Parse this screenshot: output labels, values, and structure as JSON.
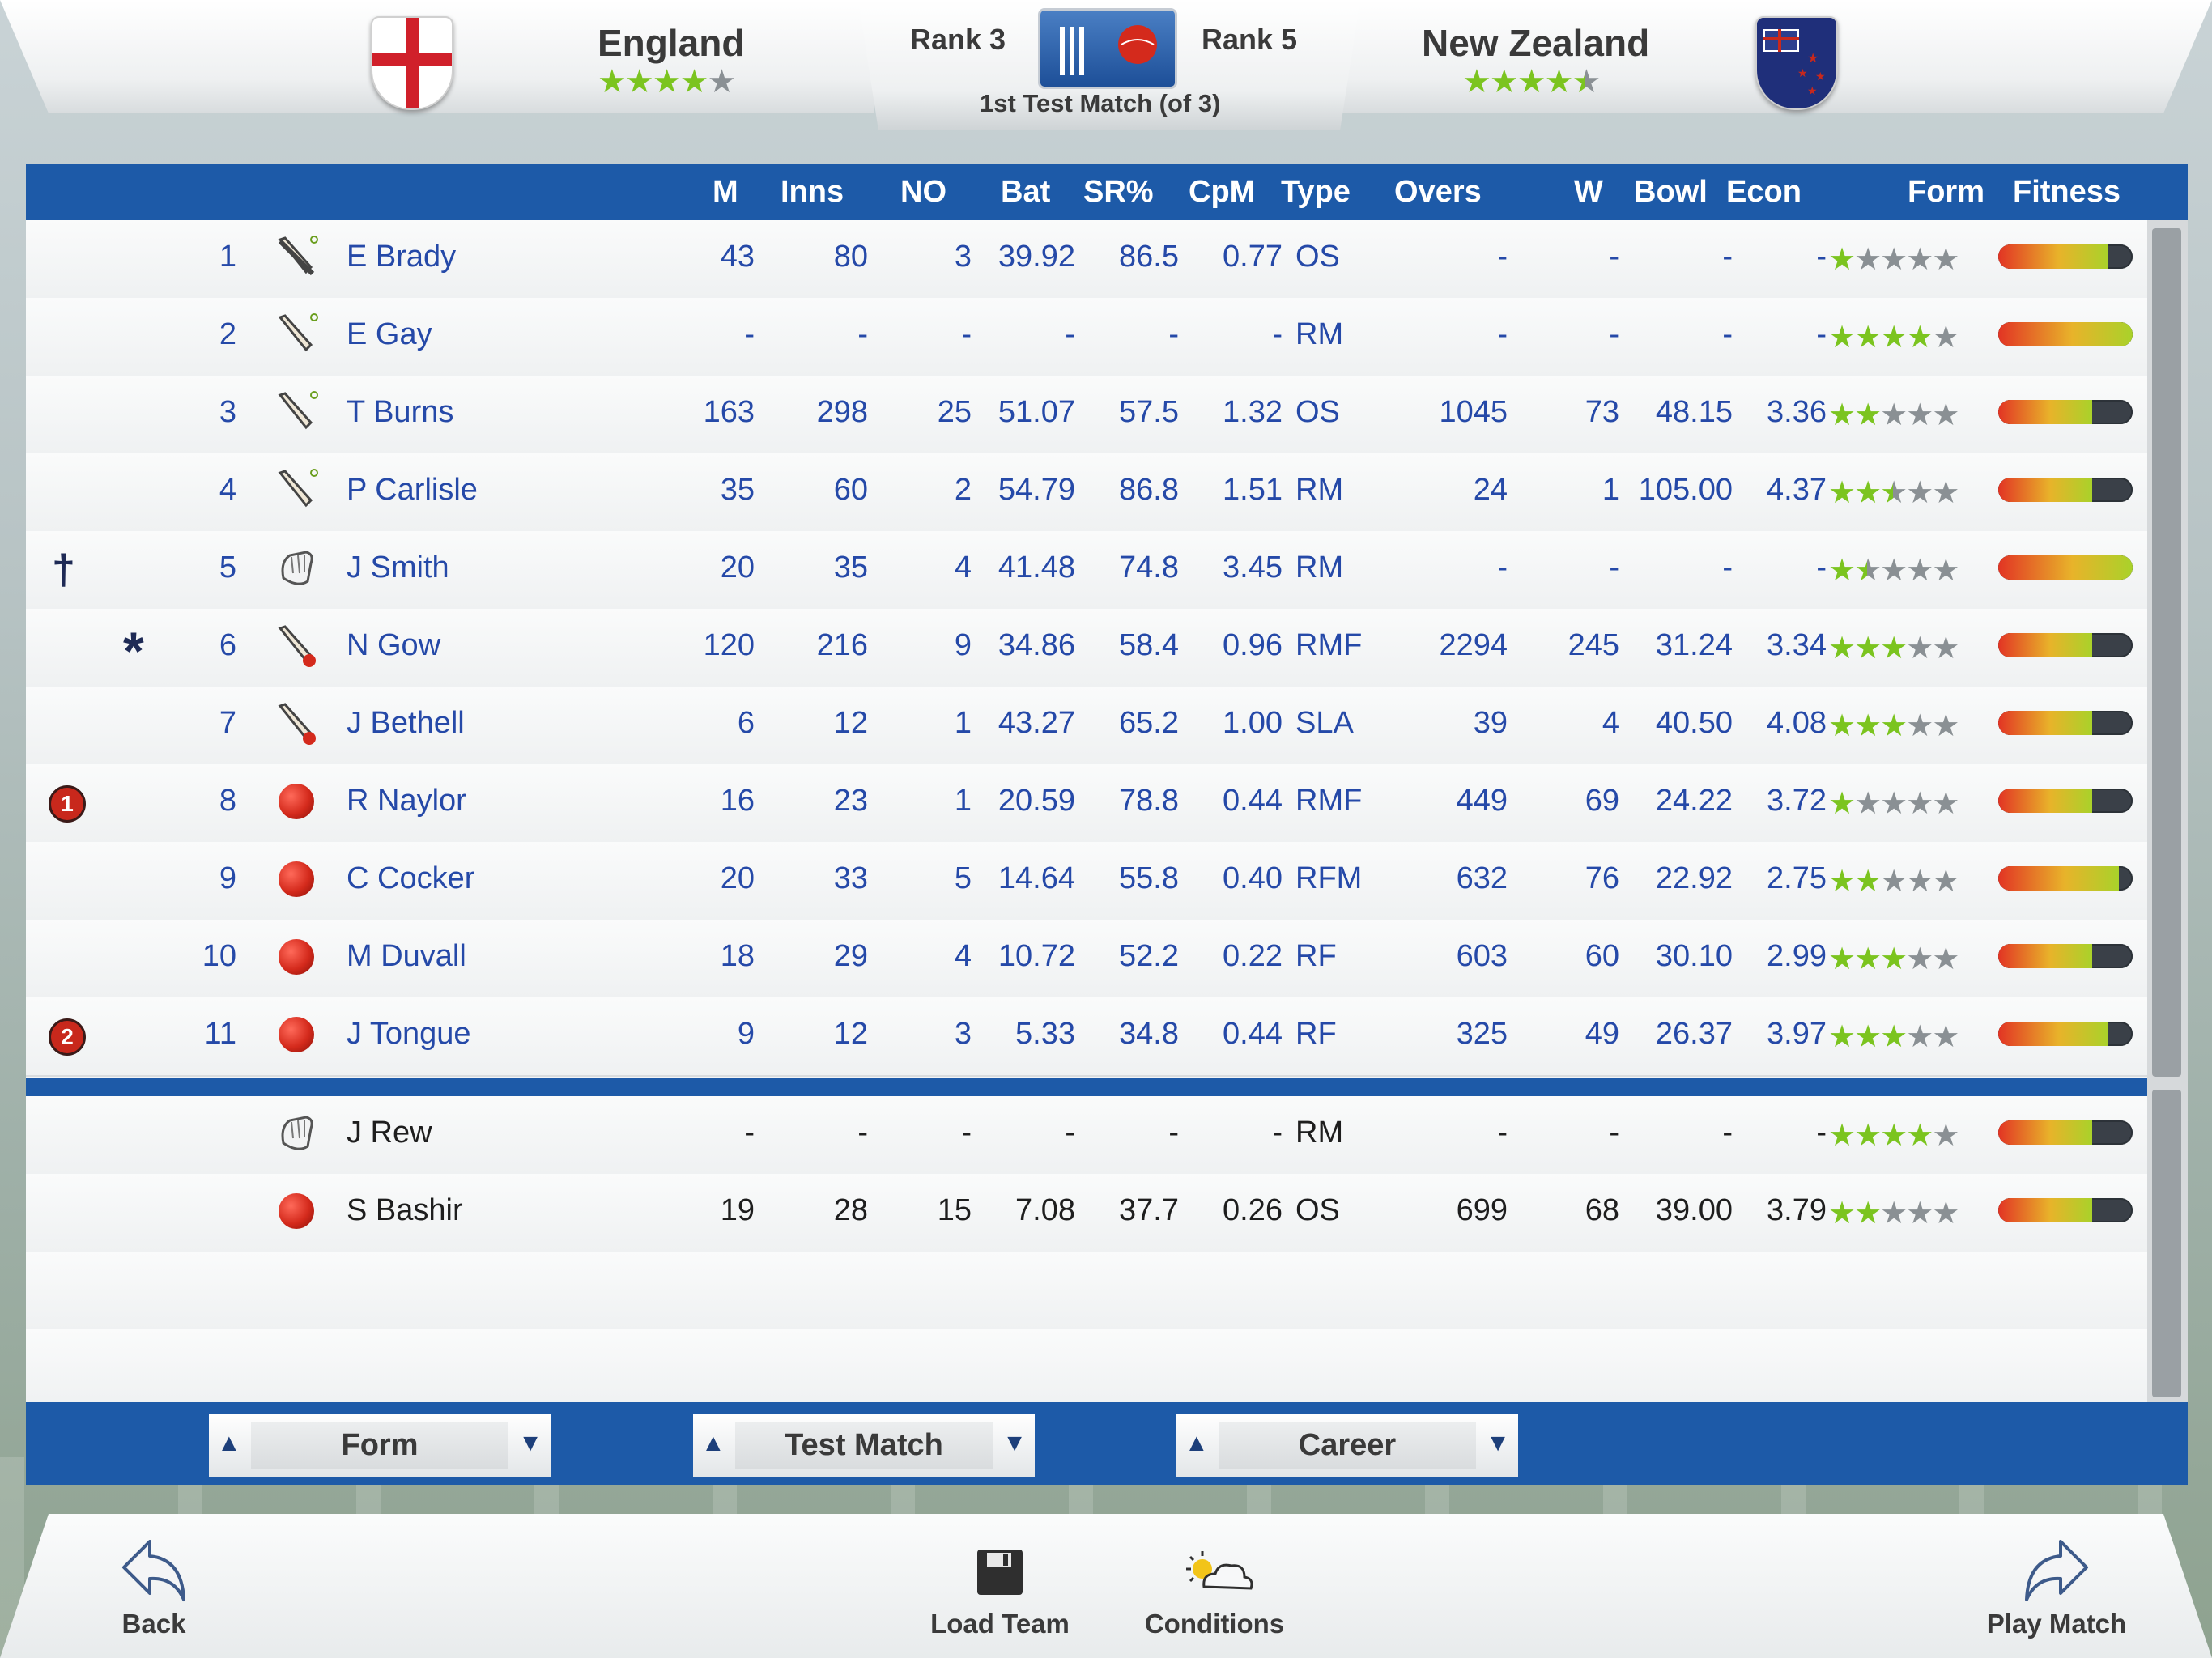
{
  "header": {
    "home_team": "England",
    "away_team": "New Zealand",
    "home_rank": "Rank 3",
    "away_rank": "Rank 5",
    "match_title": "1st Test Match (of 3)",
    "home_stars": 4,
    "away_stars": 4.5
  },
  "columns": [
    "M",
    "Inns",
    "NO",
    "Bat",
    "SR%",
    "CpM",
    "Type",
    "Overs",
    "W",
    "Bowl",
    "Econ",
    "Form",
    "Fitness"
  ],
  "players": [
    {
      "num": "1",
      "name": "E Brady",
      "role": "wk-bat",
      "M": "43",
      "Inns": "80",
      "NO": "3",
      "Bat": "39.92",
      "SR": "86.5",
      "CpM": "0.77",
      "Type": "OS",
      "Overs": "-",
      "W": "-",
      "Bowl": "-",
      "Econ": "-",
      "form": 1,
      "fitness": 0.82,
      "mark": ""
    },
    {
      "num": "2",
      "name": "E Gay",
      "role": "bat",
      "M": "-",
      "Inns": "-",
      "NO": "-",
      "Bat": "-",
      "SR": "-",
      "CpM": "-",
      "Type": "RM",
      "Overs": "-",
      "W": "-",
      "Bowl": "-",
      "Econ": "-",
      "form": 4,
      "fitness": 1.0,
      "mark": ""
    },
    {
      "num": "3",
      "name": "T Burns",
      "role": "bat",
      "M": "163",
      "Inns": "298",
      "NO": "25",
      "Bat": "51.07",
      "SR": "57.5",
      "CpM": "1.32",
      "Type": "OS",
      "Overs": "1045",
      "W": "73",
      "Bowl": "48.15",
      "Econ": "3.36",
      "form": 2,
      "fitness": 0.7,
      "mark": ""
    },
    {
      "num": "4",
      "name": "P Carlisle",
      "role": "bat",
      "M": "35",
      "Inns": "60",
      "NO": "2",
      "Bat": "54.79",
      "SR": "86.8",
      "CpM": "1.51",
      "Type": "RM",
      "Overs": "24",
      "W": "1",
      "Bowl": "105.00",
      "Econ": "4.37",
      "form": 2.5,
      "fitness": 0.7,
      "mark": ""
    },
    {
      "num": "5",
      "name": "J Smith",
      "role": "gloves",
      "M": "20",
      "Inns": "35",
      "NO": "4",
      "Bat": "41.48",
      "SR": "74.8",
      "CpM": "3.45",
      "Type": "RM",
      "Overs": "-",
      "W": "-",
      "Bowl": "-",
      "Econ": "-",
      "form": 1.5,
      "fitness": 1.0,
      "mark": "†"
    },
    {
      "num": "6",
      "name": "N Gow",
      "role": "allround",
      "M": "120",
      "Inns": "216",
      "NO": "9",
      "Bat": "34.86",
      "SR": "58.4",
      "CpM": "0.96",
      "Type": "RMF",
      "Overs": "2294",
      "W": "245",
      "Bowl": "31.24",
      "Econ": "3.34",
      "form": 3,
      "fitness": 0.7,
      "mark": "*"
    },
    {
      "num": "7",
      "name": "J Bethell",
      "role": "allround",
      "M": "6",
      "Inns": "12",
      "NO": "1",
      "Bat": "43.27",
      "SR": "65.2",
      "CpM": "1.00",
      "Type": "SLA",
      "Overs": "39",
      "W": "4",
      "Bowl": "40.50",
      "Econ": "4.08",
      "form": 3,
      "fitness": 0.7,
      "mark": ""
    },
    {
      "num": "8",
      "name": "R Naylor",
      "role": "ball",
      "M": "16",
      "Inns": "23",
      "NO": "1",
      "Bat": "20.59",
      "SR": "78.8",
      "CpM": "0.44",
      "Type": "RMF",
      "Overs": "449",
      "W": "69",
      "Bowl": "24.22",
      "Econ": "3.72",
      "form": 1,
      "fitness": 0.7,
      "mark": "1"
    },
    {
      "num": "9",
      "name": "C Cocker",
      "role": "ball",
      "M": "20",
      "Inns": "33",
      "NO": "5",
      "Bat": "14.64",
      "SR": "55.8",
      "CpM": "0.40",
      "Type": "RFM",
      "Overs": "632",
      "W": "76",
      "Bowl": "22.92",
      "Econ": "2.75",
      "form": 2,
      "fitness": 0.9,
      "mark": ""
    },
    {
      "num": "10",
      "name": "M Duvall",
      "role": "ball",
      "M": "18",
      "Inns": "29",
      "NO": "4",
      "Bat": "10.72",
      "SR": "52.2",
      "CpM": "0.22",
      "Type": "RF",
      "Overs": "603",
      "W": "60",
      "Bowl": "30.10",
      "Econ": "2.99",
      "form": 3,
      "fitness": 0.7,
      "mark": ""
    },
    {
      "num": "11",
      "name": "J Tongue",
      "role": "ball",
      "M": "9",
      "Inns": "12",
      "NO": "3",
      "Bat": "5.33",
      "SR": "34.8",
      "CpM": "0.44",
      "Type": "RF",
      "Overs": "325",
      "W": "49",
      "Bowl": "26.37",
      "Econ": "3.97",
      "form": 3,
      "fitness": 0.82,
      "mark": "2"
    }
  ],
  "reserves": [
    {
      "num": "",
      "name": "J Rew",
      "role": "gloves",
      "M": "-",
      "Inns": "-",
      "NO": "-",
      "Bat": "-",
      "SR": "-",
      "CpM": "-",
      "Type": "RM",
      "Overs": "-",
      "W": "-",
      "Bowl": "-",
      "Econ": "-",
      "form": 4,
      "fitness": 0.7,
      "mark": ""
    },
    {
      "num": "",
      "name": "S Bashir",
      "role": "ball",
      "M": "19",
      "Inns": "28",
      "NO": "15",
      "Bat": "7.08",
      "SR": "37.7",
      "CpM": "0.26",
      "Type": "OS",
      "Overs": "699",
      "W": "68",
      "Bowl": "39.00",
      "Econ": "3.79",
      "form": 2,
      "fitness": 0.7,
      "mark": ""
    }
  ],
  "dropdowns": [
    "Form",
    "Test Match",
    "Career"
  ],
  "bottom_buttons": {
    "back": "Back",
    "load": "Load Team",
    "conditions": "Conditions",
    "play": "Play Match"
  },
  "colors": {
    "header_blue": "#1d5aa8",
    "name_blue": "#2549a8",
    "star_green": "#7bc41f"
  }
}
